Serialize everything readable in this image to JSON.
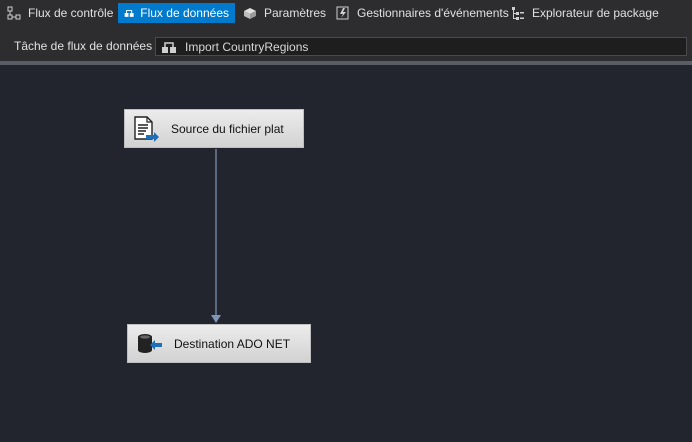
{
  "tabs": [
    {
      "label": "Flux de contrôle",
      "icon": "control-flow-icon",
      "active": false
    },
    {
      "label": "Flux de données",
      "icon": "data-flow-icon",
      "active": true
    },
    {
      "label": "Paramètres",
      "icon": "parameters-icon",
      "active": false
    },
    {
      "label": "Gestionnaires d'événements",
      "icon": "event-handlers-icon",
      "active": false
    },
    {
      "label": "Explorateur de package",
      "icon": "package-explorer-icon",
      "active": false
    }
  ],
  "task": {
    "label": "Tâche de flux de données :",
    "selected": "Import CountryRegions"
  },
  "components": [
    {
      "label": "Source du fichier plat",
      "icon": "flat-file-source-icon"
    },
    {
      "label": "Destination ADO NET",
      "icon": "ado-net-destination-icon"
    }
  ],
  "colors": {
    "active_tab": "#007acc",
    "canvas": "#22252d",
    "connector": "#7f95b8"
  }
}
